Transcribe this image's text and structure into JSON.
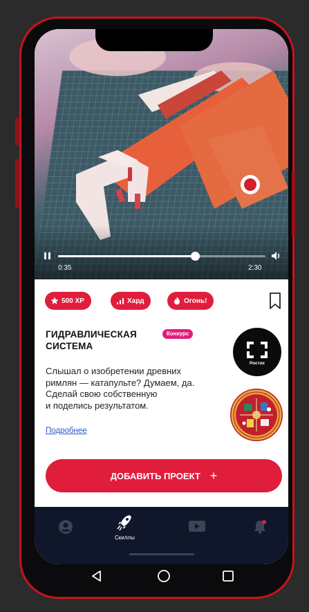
{
  "video": {
    "current_time": "0:35",
    "total_time": "2:30",
    "progress": 0.66
  },
  "chips": [
    {
      "label": "500 XP",
      "icon": "star-icon"
    },
    {
      "label": "Хард",
      "icon": "signal-bars-icon"
    },
    {
      "label": "Огонь!",
      "icon": "flame-icon"
    }
  ],
  "project": {
    "title_line1": "ГИДРАВЛИЧЕСКАЯ",
    "title_line2": "СИСТЕМА",
    "badge": "Конкурс",
    "description": [
      "Слышал о изобретении древних",
      "римлян — катапульте? Думаем, да.",
      "Сделай свою собственную",
      "и поделись результатом."
    ],
    "more_link": "Подробнее",
    "partner_label": "Ростех"
  },
  "add_button": {
    "label": "ДОБАВИТЬ ПРОЕКТ",
    "plus": "+"
  },
  "nav": [
    {
      "icon": "profile-icon",
      "label": ""
    },
    {
      "icon": "rocket-icon",
      "label": "Скиллы",
      "active": true
    },
    {
      "icon": "play-video-icon",
      "label": ""
    },
    {
      "icon": "bell-icon",
      "label": ""
    }
  ],
  "colors": {
    "accent": "#e11d3c",
    "nav_bg": "#10172a",
    "frame": "#c8121d"
  }
}
